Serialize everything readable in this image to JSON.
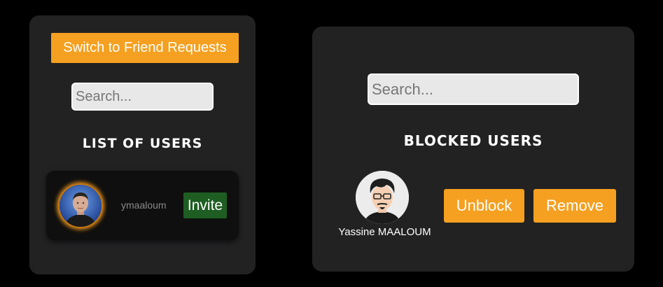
{
  "friends_panel": {
    "switch_label": "Switch to Friend Requests",
    "search_placeholder": "Search...",
    "heading": "LIST OF USERS",
    "users": [
      {
        "username": "ymaaloum",
        "invite_label": "Invite",
        "avatar_icon": "user-photo-avatar"
      }
    ]
  },
  "blocked_panel": {
    "search_placeholder": "Search...",
    "heading": "BLOCKED USERS",
    "users": [
      {
        "display_name": "Yassine MAALOUM",
        "unblock_label": "Unblock",
        "remove_label": "Remove",
        "avatar_icon": "cartoon-avatar"
      }
    ]
  },
  "colors": {
    "accent": "#f5a020",
    "invite": "#1e5e22",
    "panel": "#222223",
    "background": "#000000"
  }
}
